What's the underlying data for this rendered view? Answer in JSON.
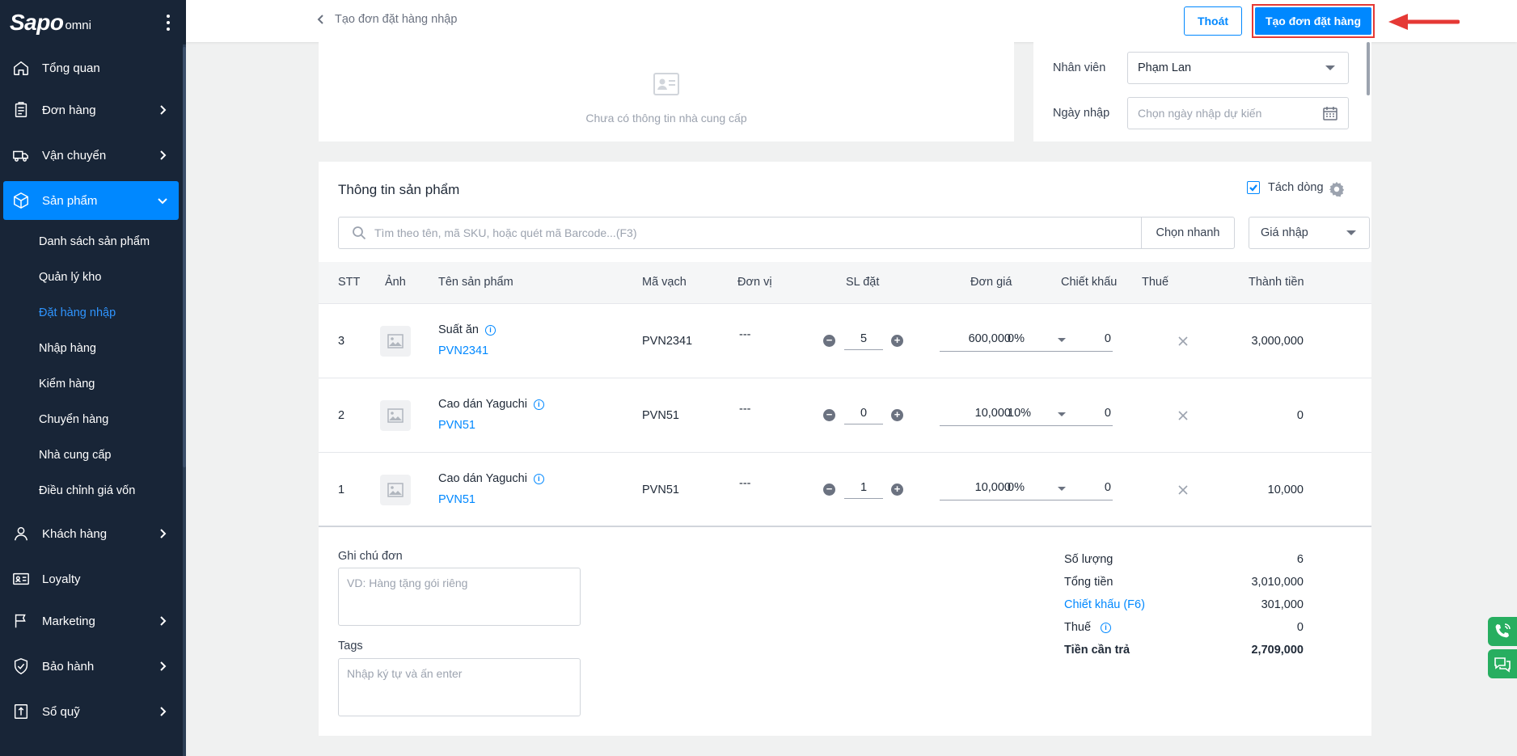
{
  "app": {
    "logo": "Sapo",
    "logo_suffix": "omni"
  },
  "sidebar": {
    "items": [
      {
        "label": "Tổng quan",
        "icon": "home-icon"
      },
      {
        "label": "Đơn hàng",
        "icon": "clipboard-icon"
      },
      {
        "label": "Vận chuyển",
        "icon": "truck-icon"
      },
      {
        "label": "Sản phẩm",
        "icon": "box-icon"
      },
      {
        "label": "Khách hàng",
        "icon": "user-icon"
      },
      {
        "label": "Loyalty",
        "icon": "card-icon"
      },
      {
        "label": "Marketing",
        "icon": "flag-icon"
      },
      {
        "label": "Bảo hành",
        "icon": "shield-icon"
      },
      {
        "label": "Sổ quỹ",
        "icon": "wallet-icon"
      }
    ],
    "sub_items": [
      "Danh sách sản phẩm",
      "Quản lý kho",
      "Đặt hàng nhập",
      "Nhập hàng",
      "Kiểm hàng",
      "Chuyển hàng",
      "Nhà cung cấp",
      "Điều chỉnh giá vốn"
    ],
    "active_item": "Sản phẩm",
    "active_sub": "Đặt hàng nhập"
  },
  "header": {
    "back_label": "Tạo đơn đặt hàng nhập",
    "exit_label": "Thoát",
    "create_label": "Tạo đơn đặt hàng"
  },
  "supplier": {
    "empty_text": "Chưa có thông tin nhà cung cấp"
  },
  "info": {
    "staff_label": "Nhân viên",
    "staff_value": "Phạm Lan",
    "date_label": "Ngày nhập",
    "date_placeholder": "Chọn ngày nhập dự kiến"
  },
  "products": {
    "title": "Thông tin sản phẩm",
    "split_label": "Tách dòng",
    "search_placeholder": "Tìm theo tên, mã SKU, hoặc quét mã Barcode...(F3)",
    "quick_label": "Chọn nhanh",
    "price_select": "Giá nhập",
    "columns": [
      "STT",
      "Ảnh",
      "Tên sản phẩm",
      "Mã vạch",
      "Đơn vị",
      "SL đặt",
      "Đơn giá",
      "Chiết khấu",
      "Thuế",
      "Thành tiền"
    ],
    "rows": [
      {
        "stt": "3",
        "name": "Suất ăn",
        "sku": "PVN2341",
        "barcode": "PVN2341",
        "unit": "---",
        "qty": "5",
        "price": "600,000",
        "discount": "0",
        "tax": "0%",
        "total": "3,000,000"
      },
      {
        "stt": "2",
        "name": "Cao dán Yaguchi",
        "sku": "PVN51",
        "barcode": "PVN51",
        "unit": "---",
        "qty": "0",
        "price": "10,000",
        "discount": "0",
        "tax": "10%",
        "total": "0"
      },
      {
        "stt": "1",
        "name": "Cao dán Yaguchi",
        "sku": "PVN51",
        "barcode": "PVN51",
        "unit": "---",
        "qty": "1",
        "price": "10,000",
        "discount": "0",
        "tax": "0%",
        "total": "10,000"
      }
    ]
  },
  "note": {
    "label": "Ghi chú đơn",
    "placeholder": "VD: Hàng tặng gói riêng"
  },
  "tags": {
    "label": "Tags",
    "placeholder": "Nhập ký tự và ấn enter"
  },
  "summary": {
    "qty_label": "Số lượng",
    "qty_value": "6",
    "total_label": "Tổng tiền",
    "total_value": "3,010,000",
    "discount_label": "Chiết khấu (F6)",
    "discount_value": "301,000",
    "tax_label": "Thuế",
    "tax_value": "0",
    "pay_label": "Tiền cần trả",
    "pay_value": "2,709,000"
  },
  "colors": {
    "accent": "#0088ff",
    "sidebar_bg": "#182537",
    "highlight": "#e53935",
    "widget": "#27ae60"
  }
}
